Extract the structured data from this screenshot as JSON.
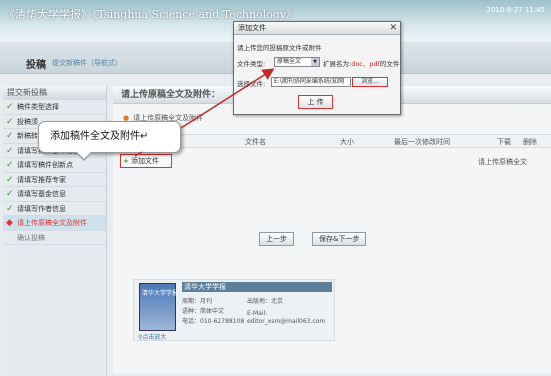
{
  "banner": {
    "title": "《清华大学学报》《Tsinghua Science and Technology》",
    "date": "2010-8-27 11:45"
  },
  "subheader": {
    "title": "投稿",
    "breadcrumb": "提交新稿件（导航式）"
  },
  "sidebar": {
    "heading": "提交新投稿",
    "items": [
      {
        "label": "稿件类型选择",
        "done": true
      },
      {
        "label": "投稿须",
        "done": true
      },
      {
        "label": "新稿转",
        "done": true
      },
      {
        "label": "请填写稿件基本信息",
        "done": true
      },
      {
        "label": "请填写稿件创新点",
        "done": true
      },
      {
        "label": "请填写推荐专家",
        "done": true
      },
      {
        "label": "请填写基金信息",
        "done": true
      },
      {
        "label": "请填写作者信息",
        "done": true
      },
      {
        "label": "请上传原稿全文及附件",
        "active": true
      },
      {
        "label": "确认投稿"
      }
    ]
  },
  "main": {
    "heading": "请上传原稿全文及附件：",
    "note": "请上传原稿全文及附件",
    "columns": {
      "file": "文件名",
      "size": "大小",
      "modified": "最后一次修改时间",
      "download": "下载",
      "delete": "删除"
    },
    "add_file_label": "添加文件",
    "right_note": "请上传原稿全文",
    "prev_button": "上一步",
    "next_button": "保存&下一步"
  },
  "journal": {
    "name": "清华大学学报",
    "cover_text": "清华大学学报",
    "zoom": "点击放大",
    "period_label": "周期：月刊",
    "language_label": "语种：简体中文",
    "phone_label": "电话：010-62788108",
    "location_label": "出版地：北京",
    "email_label": "E-Mail:",
    "email": "editor_xsm@mail063.com"
  },
  "dialog": {
    "title": "添加文件",
    "close": "✕",
    "instruction": "请上传您的投稿原文件或附件",
    "type_label": "文件类型:",
    "type_value": "原稿全文",
    "ext_prefix": "扩展名为:",
    "ext_value": "doc、pdf",
    "ext_suffix": "的文件",
    "select_label": "选择文件:",
    "file_path": "E:\\期刊协同采编系统(知网",
    "browse_button": "浏览...",
    "upload_button": "上 传"
  },
  "callout": {
    "text": "添加稿件全文及附件↵"
  },
  "colors": {
    "highlight": "#e03030",
    "done_check": "#2e9d2e",
    "active_text": "#d33333"
  }
}
